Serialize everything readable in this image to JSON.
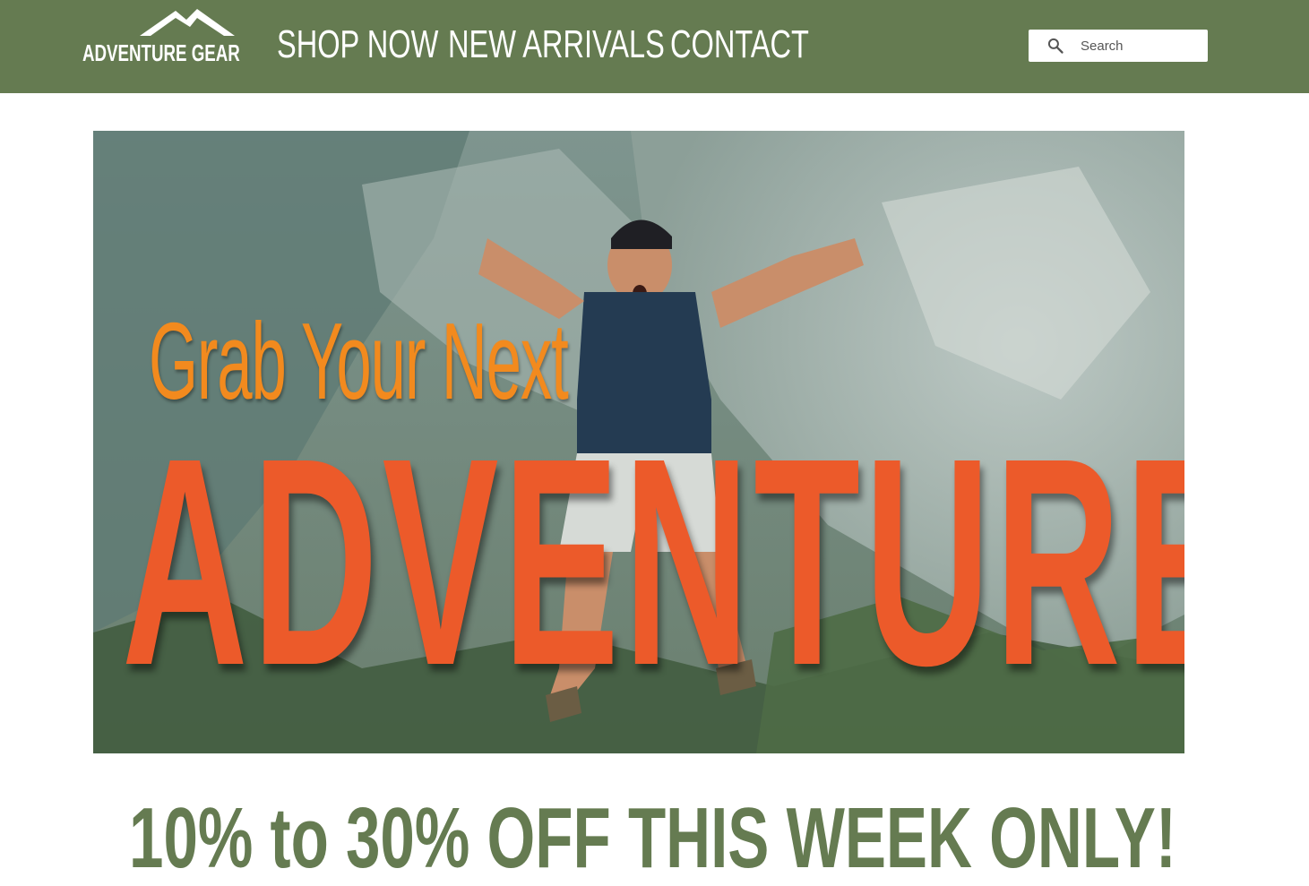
{
  "header": {
    "logo_text": "ADVENTURE GEAR",
    "nav": [
      {
        "label": "SHOP NOW"
      },
      {
        "label": "NEW ARRIVALS"
      },
      {
        "label": "CONTACT"
      }
    ],
    "search": {
      "placeholder": "Search",
      "value": ""
    }
  },
  "hero": {
    "line1": "Grab Your Next",
    "line2": "ADVENTURE"
  },
  "promo": {
    "text": "10% to 30% OFF THIS WEEK ONLY!"
  },
  "colors": {
    "header_bg": "#657b51",
    "accent_orange": "#f28a1e",
    "accent_red_orange": "#ec5a2a",
    "promo_green": "#657b51"
  },
  "icons": {
    "logo": "mountain-logo-icon",
    "search": "search-icon"
  }
}
